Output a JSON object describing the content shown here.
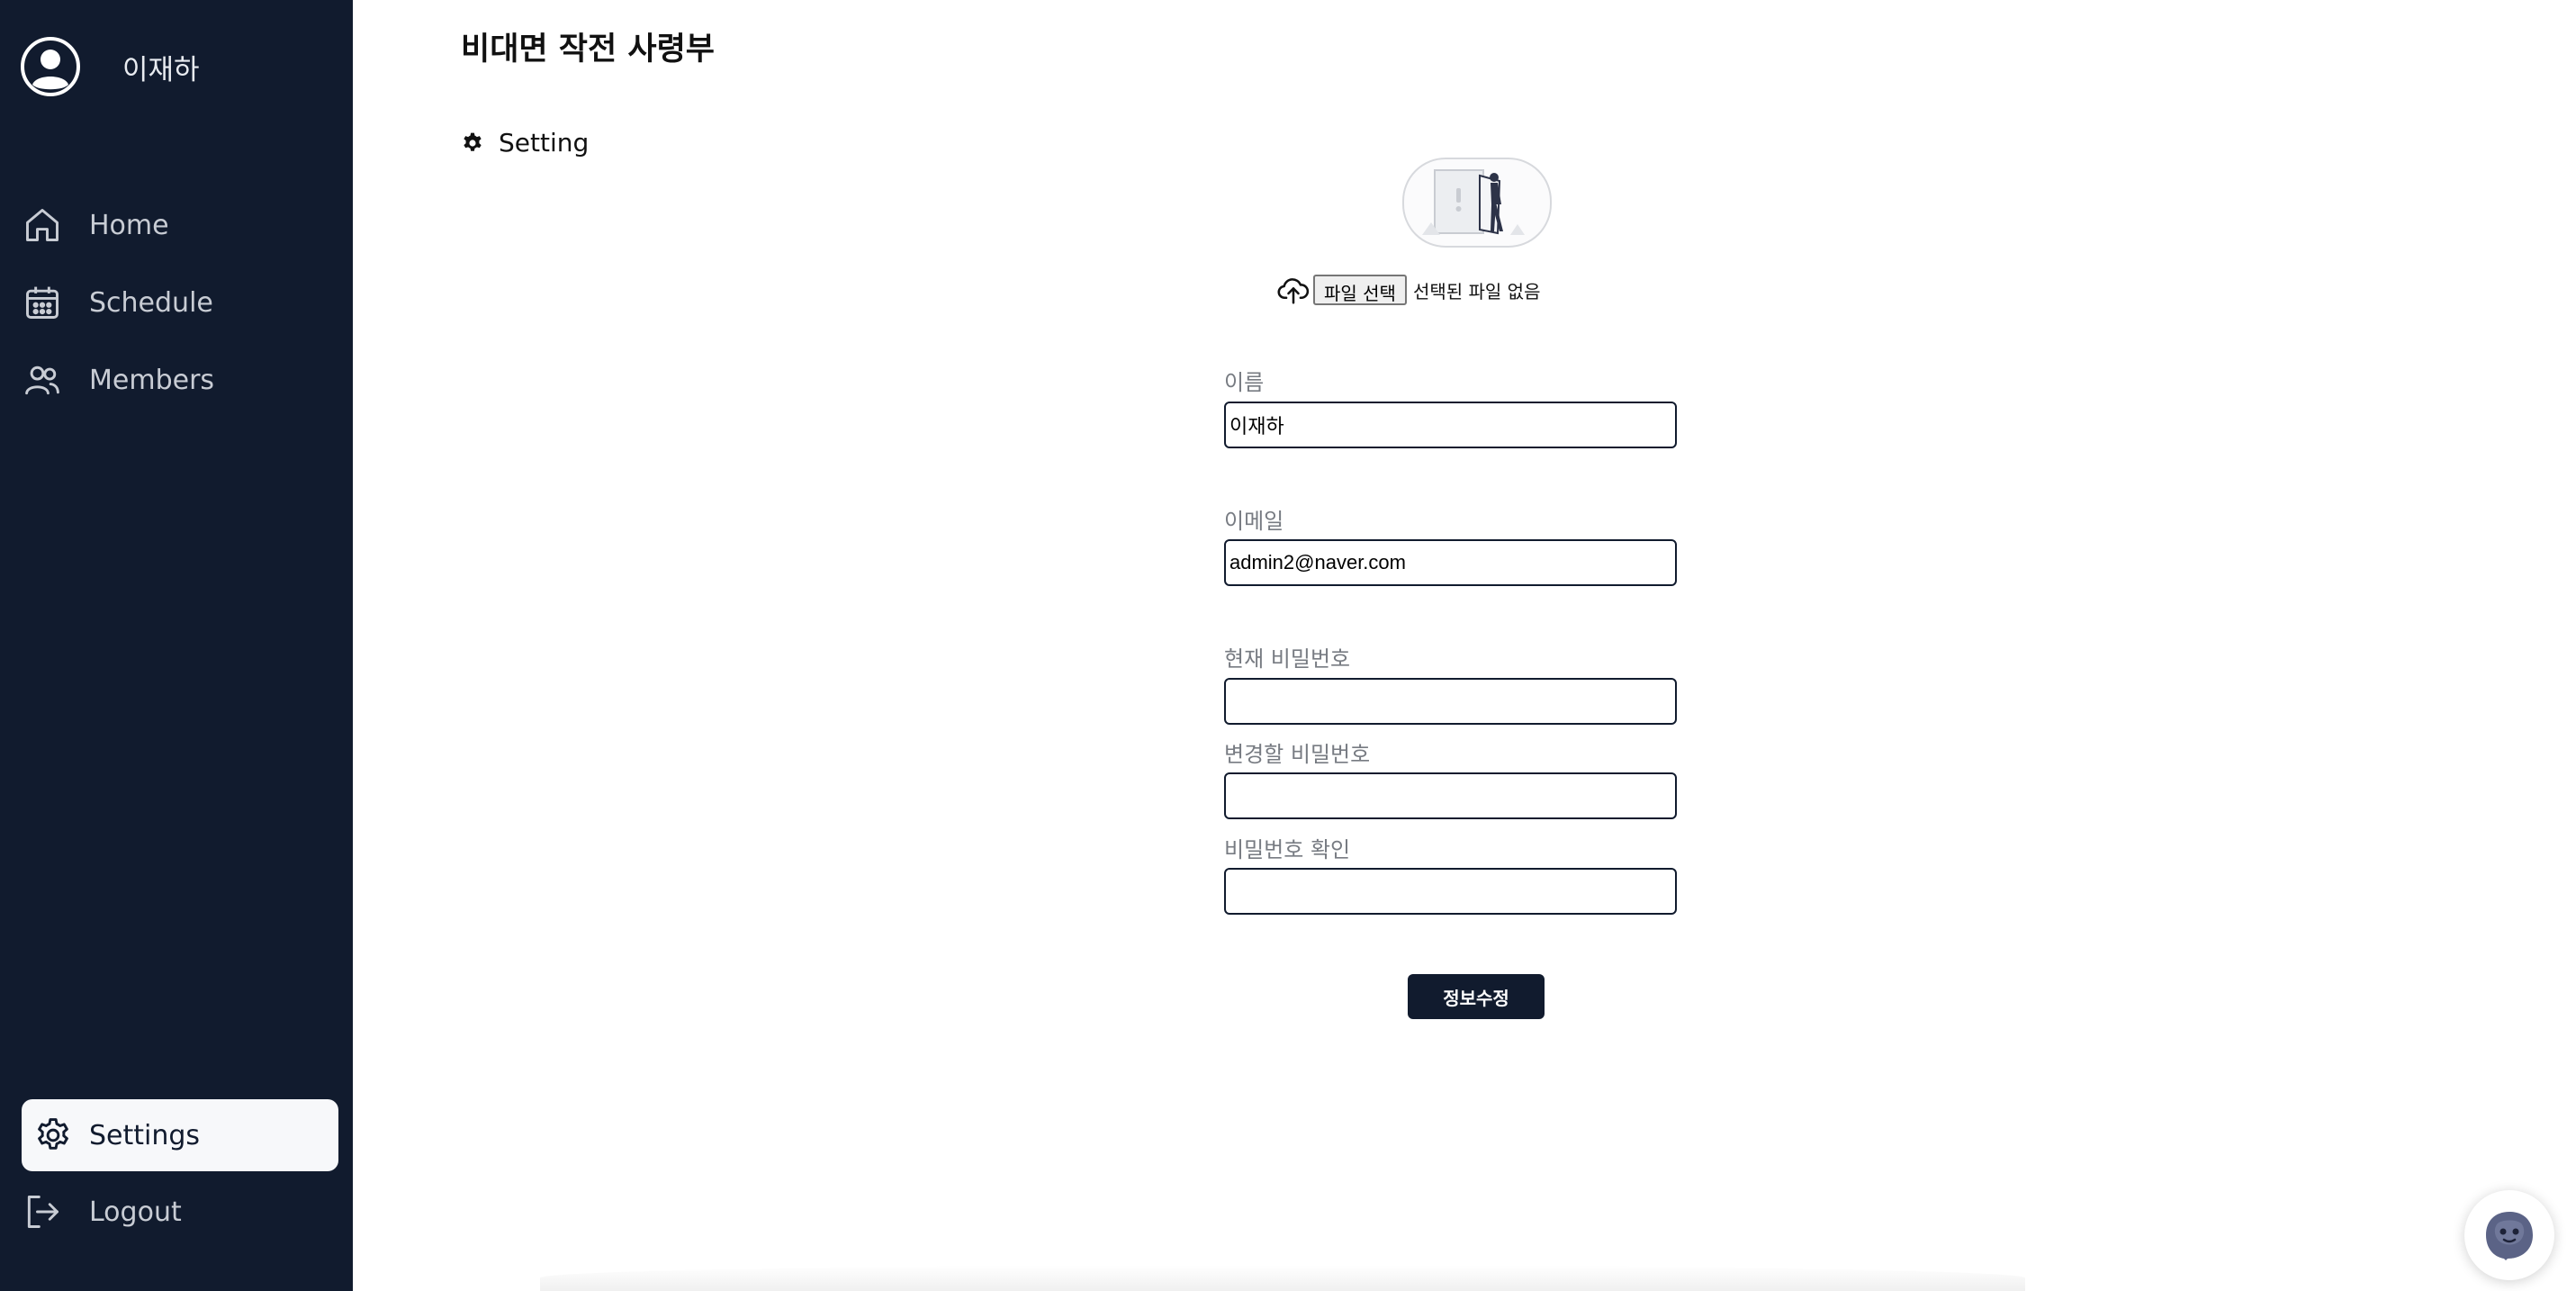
{
  "user": {
    "name": "이재하"
  },
  "sidebar": {
    "items": [
      {
        "label": "Home",
        "icon": "home-icon"
      },
      {
        "label": "Schedule",
        "icon": "calendar-icon"
      },
      {
        "label": "Members",
        "icon": "users-icon"
      }
    ],
    "settings_label": "Settings",
    "logout_label": "Logout"
  },
  "main": {
    "title": "비대면 작전 사령부",
    "section_title": "Setting",
    "upload": {
      "button_label": "파일 선택",
      "status": "선택된 파일 없음"
    },
    "fields": {
      "name_label": "이름",
      "name_value": "이재하",
      "email_label": "이메일",
      "email_value": "admin2@naver.com",
      "current_password_label": "현재 비밀번호",
      "new_password_label": "변경할 비밀번호",
      "confirm_password_label": "비밀번호 확인"
    },
    "submit_label": "정보수정"
  },
  "colors": {
    "sidebar_bg": "#111b2e",
    "accent": "#111b2e",
    "label_gray": "#777b82"
  }
}
